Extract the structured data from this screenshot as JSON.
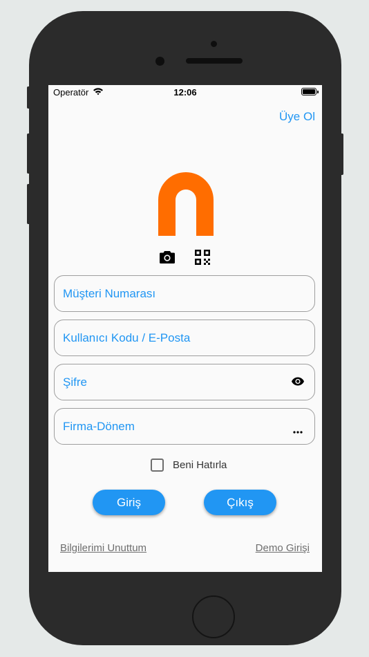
{
  "status_bar": {
    "carrier": "Operatör",
    "time": "12:06"
  },
  "header": {
    "signup_label": "Üye Ol"
  },
  "form": {
    "customer_number_placeholder": "Müşteri Numarası",
    "username_placeholder": "Kullanıcı Kodu / E-Posta",
    "password_placeholder": "Şifre",
    "company_period_placeholder": "Firma-Dönem",
    "remember_label": "Beni Hatırla",
    "remember_checked": false
  },
  "actions": {
    "login_label": "Giriş",
    "exit_label": "Çıkış"
  },
  "footer": {
    "forgot_label": "Bilgilerimi Unuttum",
    "demo_label": "Demo Girişi"
  },
  "colors": {
    "accent": "#2196f3",
    "logo": "#ff6d00",
    "device": "#2b2b2b"
  },
  "icons": [
    "wifi-icon",
    "battery-icon",
    "camera-icon",
    "qr-code-icon",
    "eye-icon",
    "more-horiz-icon"
  ]
}
